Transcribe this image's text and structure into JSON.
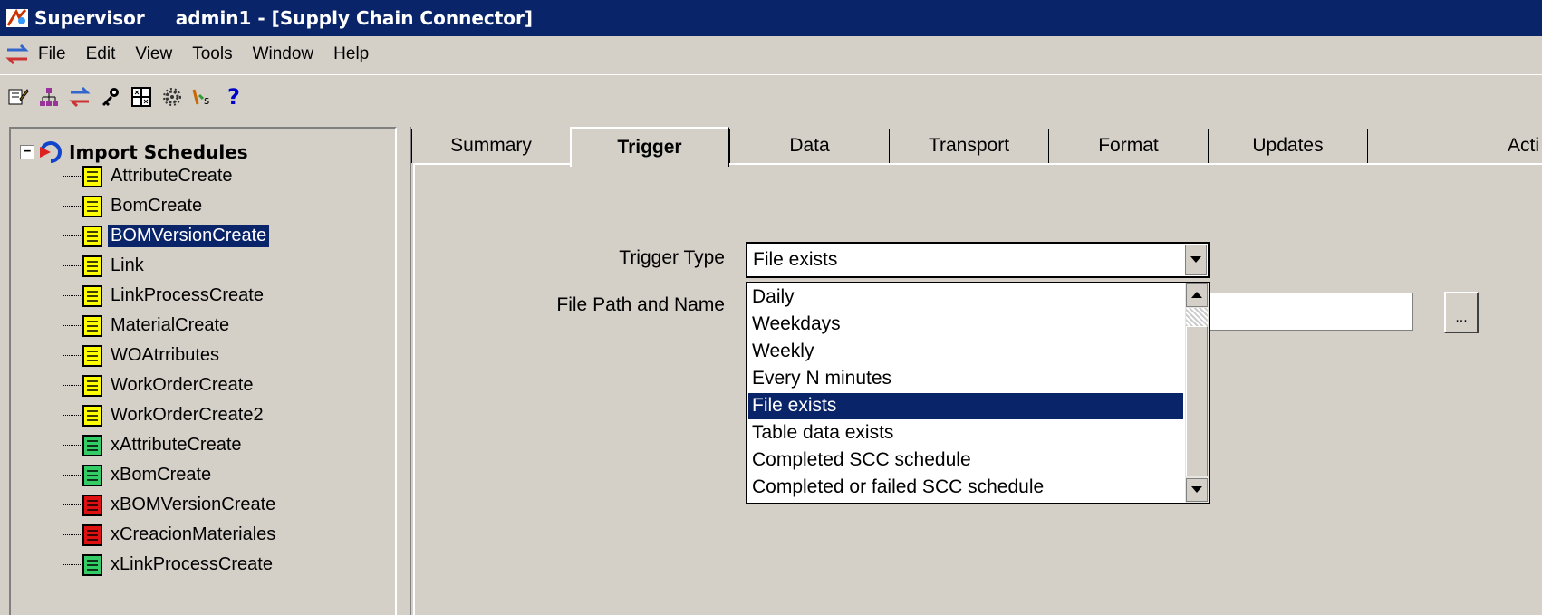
{
  "window": {
    "app_name": "Supervisor",
    "title": "admin1 - [Supply Chain Connector]"
  },
  "menu": [
    "File",
    "Edit",
    "View",
    "Tools",
    "Window",
    "Help"
  ],
  "toolbar": {
    "icons": [
      "properties-icon",
      "hierarchy-icon",
      "transfer-icon",
      "keys-icon",
      "grid-icon",
      "gear-icon",
      "script-icon",
      "help-icon"
    ],
    "help_label": "?"
  },
  "tree": {
    "expander": "−",
    "root_label": "Import Schedules",
    "items": [
      {
        "label": "AttributeCreate",
        "status": "yellow"
      },
      {
        "label": "BomCreate",
        "status": "yellow"
      },
      {
        "label": "BOMVersionCreate",
        "status": "yellow",
        "selected": true
      },
      {
        "label": "Link",
        "status": "yellow"
      },
      {
        "label": "LinkProcessCreate",
        "status": "yellow"
      },
      {
        "label": "MaterialCreate",
        "status": "yellow"
      },
      {
        "label": "WOAtrributes",
        "status": "yellow"
      },
      {
        "label": "WorkOrderCreate",
        "status": "yellow"
      },
      {
        "label": "WorkOrderCreate2",
        "status": "yellow"
      },
      {
        "label": "xAttributeCreate",
        "status": "green"
      },
      {
        "label": "xBomCreate",
        "status": "green"
      },
      {
        "label": "xBOMVersionCreate",
        "status": "red"
      },
      {
        "label": "xCreacionMateriales",
        "status": "red"
      },
      {
        "label": "xLinkProcessCreate",
        "status": "green"
      }
    ]
  },
  "tabs": [
    {
      "label": "Summary"
    },
    {
      "label": "Trigger",
      "active": true
    },
    {
      "label": "Data"
    },
    {
      "label": "Transport"
    },
    {
      "label": "Format"
    },
    {
      "label": "Updates"
    },
    {
      "label": "Acti"
    }
  ],
  "form": {
    "trigger_type_label": "Trigger Type",
    "trigger_type_value": "File exists",
    "file_path_label": "File Path and Name",
    "file_path_value": "",
    "browse_label": "..."
  },
  "dropdown": {
    "options": [
      "Daily",
      "Weekdays",
      "Weekly",
      "Every N minutes",
      "File exists",
      "Table data exists",
      "Completed SCC schedule",
      "Completed or failed SCC schedule"
    ],
    "selected": "File exists"
  },
  "colors": {
    "titlebar": "#0a246a",
    "selection": "#0a246a",
    "face": "#d4d0c8",
    "yellow_node": "#ffff00",
    "green_node": "#33cc66",
    "red_node": "#dd1111"
  }
}
